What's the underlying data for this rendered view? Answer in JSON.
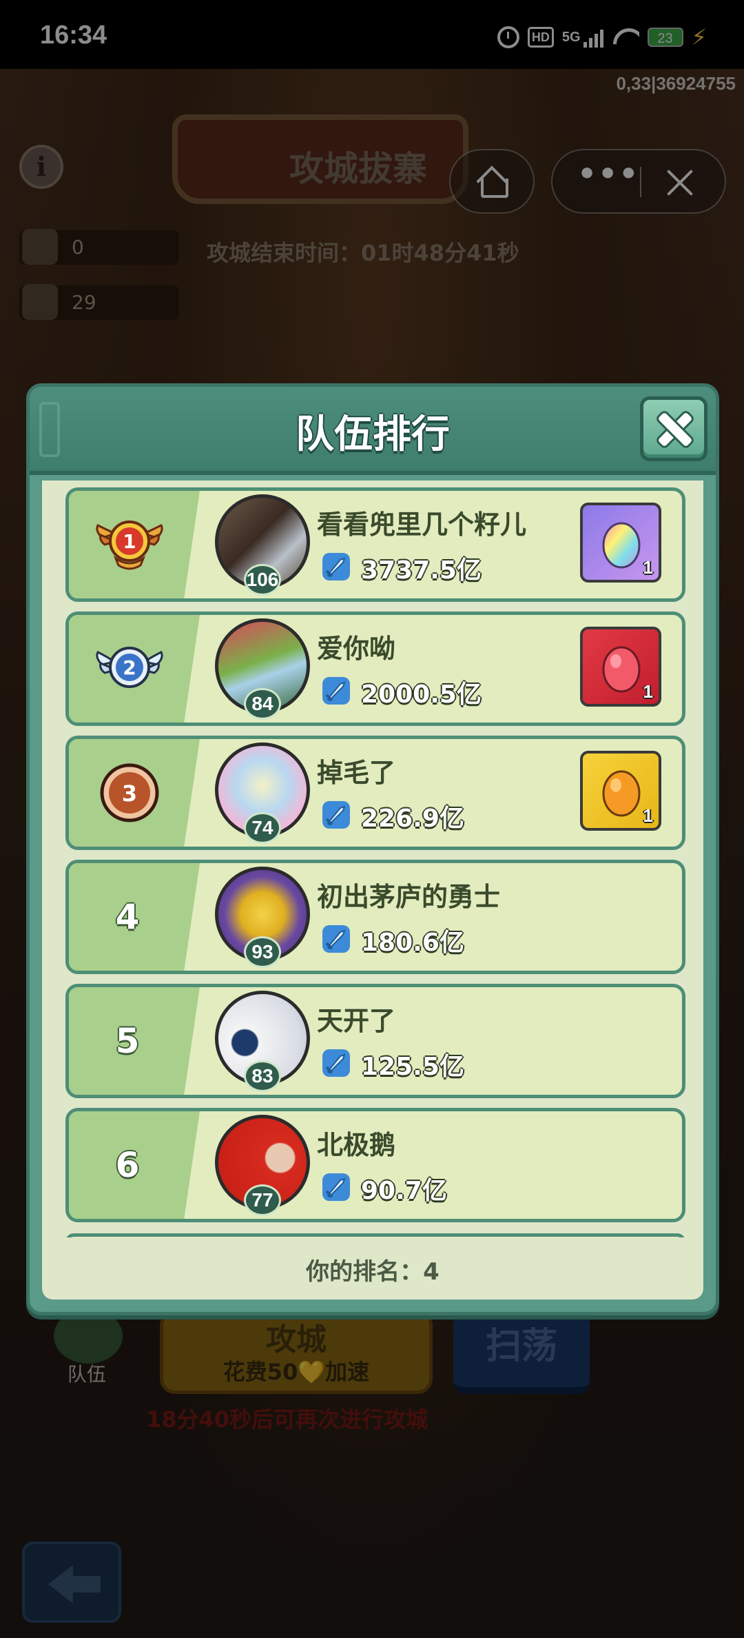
{
  "status_bar": {
    "time": "16:34",
    "network": "5G",
    "hd": "HD",
    "battery": "23"
  },
  "game": {
    "debug_text": "0,33|36924755",
    "banner_title": "攻城拔寨",
    "end_time": "攻城结束时间：01时48分41秒",
    "resources": [
      {
        "value": "0"
      },
      {
        "value": "29"
      }
    ],
    "team_label": "队伍",
    "attack_label": "攻城",
    "attack_cost": "花费50💛加速",
    "sweep_label": "扫荡",
    "cooldown": "18分40秒后可再次进行攻城"
  },
  "modal": {
    "title": "队伍排行",
    "my_rank": "你的排名：4",
    "rows": [
      {
        "rank": "1",
        "name": "看看兜里几个籽儿",
        "level": "106",
        "power": "3737.5亿",
        "reward_qty": "1",
        "reward_color": "#b98be8",
        "egg_color": "rainbow",
        "medal": "gold"
      },
      {
        "rank": "2",
        "name": "爱你呦",
        "level": "84",
        "power": "2000.5亿",
        "reward_qty": "1",
        "reward_color": "#d8303a",
        "egg_color": "#e84a5a",
        "medal": "silver"
      },
      {
        "rank": "3",
        "name": "掉毛了",
        "level": "74",
        "power": "226.9亿",
        "reward_qty": "1",
        "reward_color": "#f2c425",
        "egg_color": "#f3a21e",
        "medal": "bronze"
      },
      {
        "rank": "4",
        "name": "初出茅庐的勇士",
        "level": "93",
        "power": "180.6亿"
      },
      {
        "rank": "5",
        "name": "天开了",
        "level": "83",
        "power": "125.5亿"
      },
      {
        "rank": "6",
        "name": "北极鹅",
        "level": "77",
        "power": "90.7亿"
      }
    ]
  },
  "colors": {
    "modal_green": "#5a9a88",
    "row_bg": "#e2ecbe",
    "band_green": "#a9cf8c"
  }
}
